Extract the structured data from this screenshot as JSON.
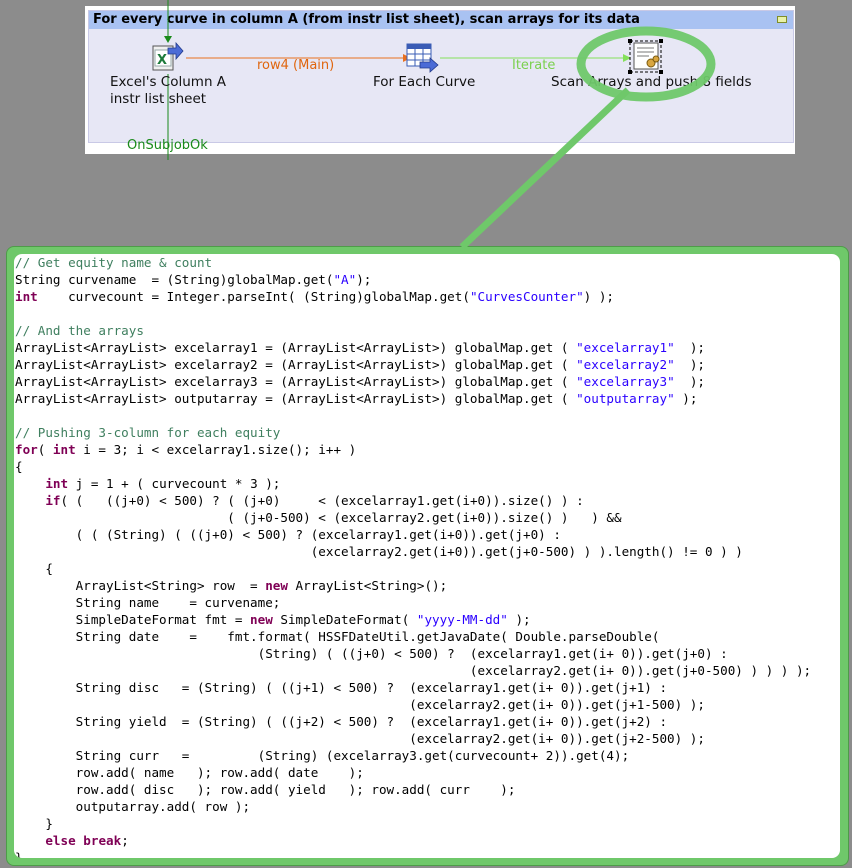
{
  "subjob": {
    "title": "For every curve in column A (from instr list sheet), scan arrays for its data"
  },
  "components": {
    "excel": {
      "label_line1": "Excel's Column A",
      "label_line2": "instr list sheet"
    },
    "foreach": {
      "label": "For Each Curve"
    },
    "scan": {
      "label": "Scan Arrays and push 8 fields"
    }
  },
  "connections": {
    "row": "row4 (Main)",
    "iterate": "Iterate",
    "trigger": "OnSubjobOk"
  },
  "colors": {
    "subjob_header": "#a9c2f2",
    "row_link": "#e87020",
    "iterate_link": "#84e05a",
    "trigger_link": "#1a8a1a",
    "highlight": "#6fc86a"
  },
  "code": {
    "lines": [
      [
        [
          "cm",
          "// Get equity name & count"
        ]
      ],
      [
        [
          "t",
          "String curvename  = (String)globalMap.get("
        ],
        [
          "st",
          "\"A\""
        ],
        [
          "t",
          ");"
        ]
      ],
      [
        [
          "kw",
          "int"
        ],
        [
          "t",
          "    curvecount = Integer.parseInt( (String)globalMap.get("
        ],
        [
          "st",
          "\"CurvesCounter\""
        ],
        [
          "t",
          ") );"
        ]
      ],
      [
        [
          "t",
          ""
        ]
      ],
      [
        [
          "cm",
          "// And the arrays"
        ]
      ],
      [
        [
          "t",
          "ArrayList<ArrayList> excelarray1 = (ArrayList<ArrayList>) globalMap.get ( "
        ],
        [
          "st",
          "\"excelarray1\""
        ],
        [
          "t",
          "  );"
        ]
      ],
      [
        [
          "t",
          "ArrayList<ArrayList> excelarray2 = (ArrayList<ArrayList>) globalMap.get ( "
        ],
        [
          "st",
          "\"excelarray2\""
        ],
        [
          "t",
          "  );"
        ]
      ],
      [
        [
          "t",
          "ArrayList<ArrayList> excelarray3 = (ArrayList<ArrayList>) globalMap.get ( "
        ],
        [
          "st",
          "\"excelarray3\""
        ],
        [
          "t",
          "  );"
        ]
      ],
      [
        [
          "t",
          "ArrayList<ArrayList> outputarray = (ArrayList<ArrayList>) globalMap.get ( "
        ],
        [
          "st",
          "\"outputarray\""
        ],
        [
          "t",
          " );"
        ]
      ],
      [
        [
          "t",
          ""
        ]
      ],
      [
        [
          "cm",
          "// Pushing 3-column for each equity"
        ]
      ],
      [
        [
          "kw",
          "for"
        ],
        [
          "t",
          "( "
        ],
        [
          "kw",
          "int"
        ],
        [
          "t",
          " i = 3; i < excelarray1.size(); i++ )"
        ]
      ],
      [
        [
          "t",
          "{"
        ]
      ],
      [
        [
          "t",
          "    "
        ],
        [
          "kw",
          "int"
        ],
        [
          "t",
          " j = 1 + ( curvecount * 3 );"
        ]
      ],
      [
        [
          "t",
          "    "
        ],
        [
          "kw",
          "if"
        ],
        [
          "t",
          "( (   ((j+0) < 500) ? ( (j+0)     < (excelarray1.get(i+0)).size() ) :"
        ]
      ],
      [
        [
          "t",
          "                            ( (j+0-500) < (excelarray2.get(i+0)).size() )   ) &&"
        ]
      ],
      [
        [
          "t",
          "        ( ( (String) ( ((j+0) < 500) ? (excelarray1.get(i+0)).get(j+0) :"
        ]
      ],
      [
        [
          "t",
          "                                       (excelarray2.get(i+0)).get(j+0-500) ) ).length() != 0 ) )"
        ]
      ],
      [
        [
          "t",
          "    {"
        ]
      ],
      [
        [
          "t",
          "        ArrayList<String> row  = "
        ],
        [
          "kw",
          "new"
        ],
        [
          "t",
          " ArrayList<String>();"
        ]
      ],
      [
        [
          "t",
          "        String name    = curvename;"
        ]
      ],
      [
        [
          "t",
          "        SimpleDateFormat fmt = "
        ],
        [
          "kw",
          "new"
        ],
        [
          "t",
          " SimpleDateFormat( "
        ],
        [
          "st",
          "\"yyyy-MM-dd\""
        ],
        [
          "t",
          " );"
        ]
      ],
      [
        [
          "t",
          "        String date    =    fmt.format( HSSFDateUtil.getJavaDate( Double.parseDouble("
        ]
      ],
      [
        [
          "t",
          "                                (String) ( ((j+0) < 500) ?  (excelarray1.get(i+ 0)).get(j+0) :"
        ]
      ],
      [
        [
          "t",
          "                                                            (excelarray2.get(i+ 0)).get(j+0-500) ) ) ) );"
        ]
      ],
      [
        [
          "t",
          "        String disc   = (String) ( ((j+1) < 500) ?  (excelarray1.get(i+ 0)).get(j+1) :"
        ]
      ],
      [
        [
          "t",
          "                                                    (excelarray2.get(i+ 0)).get(j+1-500) );"
        ]
      ],
      [
        [
          "t",
          "        String yield  = (String) ( ((j+2) < 500) ?  (excelarray1.get(i+ 0)).get(j+2) :"
        ]
      ],
      [
        [
          "t",
          "                                                    (excelarray2.get(i+ 0)).get(j+2-500) );"
        ]
      ],
      [
        [
          "t",
          "        String curr   =         (String) (excelarray3.get(curvecount+ 2)).get(4);"
        ]
      ],
      [
        [
          "t",
          "        row.add( name   ); row.add( date    );"
        ]
      ],
      [
        [
          "t",
          "        row.add( disc   ); row.add( yield   ); row.add( curr    );"
        ]
      ],
      [
        [
          "t",
          "        outputarray.add( row );"
        ]
      ],
      [
        [
          "t",
          "    }"
        ]
      ],
      [
        [
          "t",
          "    "
        ],
        [
          "kw",
          "else"
        ],
        [
          "t",
          " "
        ],
        [
          "kw",
          "break"
        ],
        [
          "t",
          ";"
        ]
      ],
      [
        [
          "t",
          "}"
        ]
      ]
    ]
  }
}
